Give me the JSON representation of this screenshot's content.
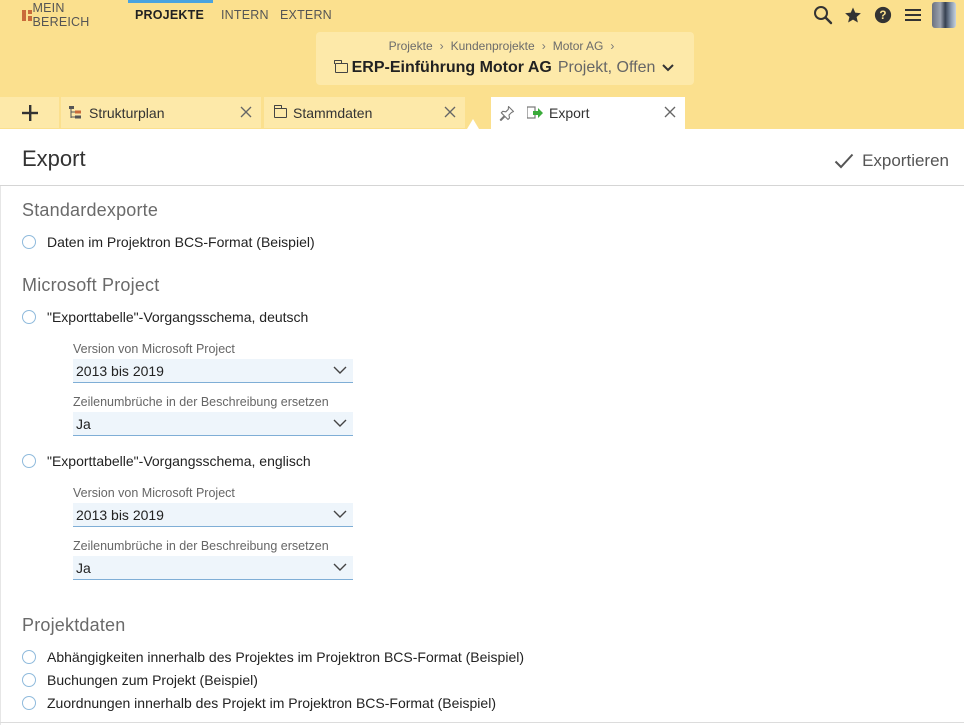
{
  "topnav": {
    "items": [
      {
        "label": "MEIN BEREICH"
      },
      {
        "label": "PROJEKTE"
      },
      {
        "label": "INTERN"
      },
      {
        "label": "EXTERN"
      }
    ]
  },
  "header_icons": [
    "search-icon",
    "star-icon",
    "help-icon",
    "menu-icon",
    "user-avatar"
  ],
  "breadcrumb": [
    "Projekte",
    "Kundenprojekte",
    "Motor AG"
  ],
  "breadcrumb_separator": "›",
  "project": {
    "title": "ERP-Einführung Motor AG",
    "status": "Projekt, Offen"
  },
  "tabs": [
    {
      "label": "Strukturplan"
    },
    {
      "label": "Stammdaten"
    },
    {
      "label": "Export"
    }
  ],
  "page": {
    "title": "Export",
    "export_button": "Exportieren"
  },
  "sections": {
    "standard": {
      "title": "Standardexporte",
      "options": [
        "Daten im Projektron BCS-Format (Beispiel)"
      ]
    },
    "msproject": {
      "title": "Microsoft Project",
      "option_de": "\"Exporttabelle\"-Vorgangsschema, deutsch",
      "option_en": "\"Exporttabelle\"-Vorgangsschema, englisch",
      "version_label": "Version von Microsoft Project",
      "version_value": "2013 bis 2019",
      "linebreak_label": "Zeilenumbrüche in der Beschreibung ersetzen",
      "linebreak_value": "Ja"
    },
    "projektdaten": {
      "title": "Projektdaten",
      "options": [
        "Abhängigkeiten innerhalb des Projektes im Projektron BCS-Format (Beispiel)",
        "Buchungen zum Projekt (Beispiel)",
        "Zuordnungen innerhalb des Projekt im Projektron BCS-Format (Beispiel)"
      ]
    }
  },
  "colors": {
    "header_bg": "#fbe08e",
    "card_bg": "#fde9a9",
    "accent": "#4aa3df",
    "radio_border": "#8fbadc",
    "select_bg": "#eef5fb"
  }
}
